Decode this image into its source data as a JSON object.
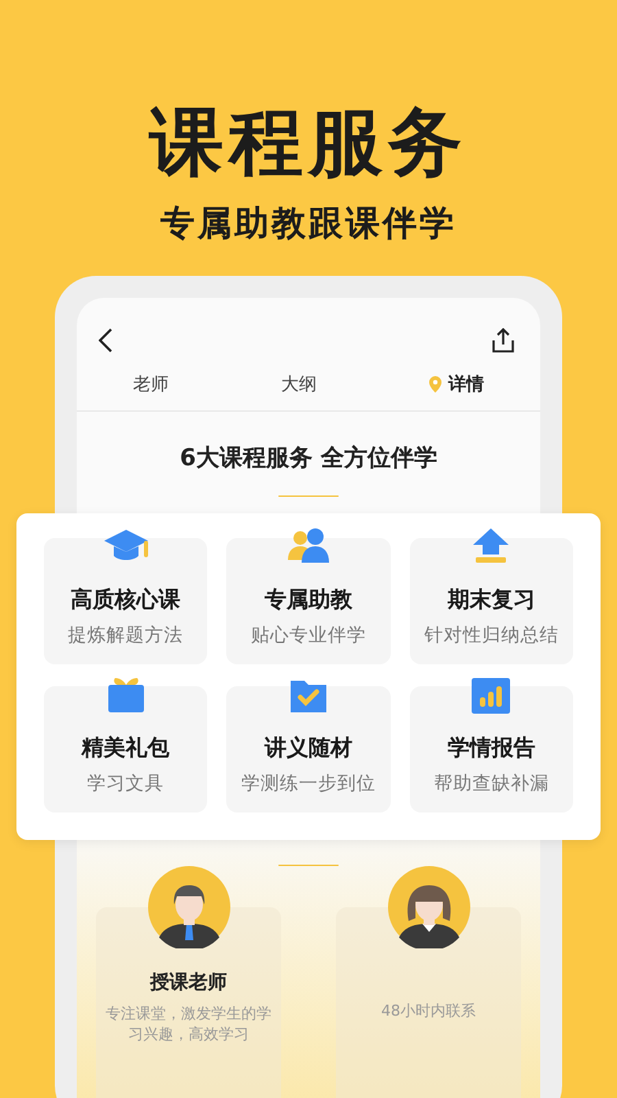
{
  "headline": "课程服务",
  "subheadline": "专属助教跟课伴学",
  "tabs": [
    {
      "label": "老师",
      "selected": false
    },
    {
      "label": "大纲",
      "selected": false
    },
    {
      "label": "详情",
      "selected": true
    }
  ],
  "section_title": "6大课程服务 全方位伴学",
  "services": [
    {
      "title": "高质核心课",
      "desc": "提炼解题方法"
    },
    {
      "title": "专属助教",
      "desc": "贴心专业伴学"
    },
    {
      "title": "期末复习",
      "desc": "针对性归纳总结"
    },
    {
      "title": "精美礼包",
      "desc": "学习文具"
    },
    {
      "title": "讲义随材",
      "desc": "学测练一步到位"
    },
    {
      "title": "学情报告",
      "desc": "帮助查缺补漏"
    }
  ],
  "staff": [
    {
      "kind": "male",
      "title": "授课老师",
      "desc": "专注课堂，激发学生的学习兴趣，高效学习"
    },
    {
      "kind": "female",
      "desc": "48小时内联系"
    }
  ]
}
